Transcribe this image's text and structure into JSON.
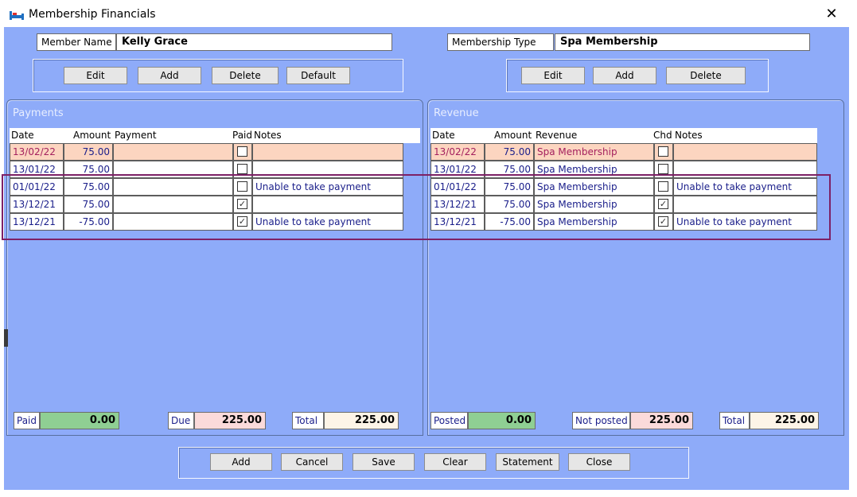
{
  "window": {
    "title": "Membership Financials",
    "close_glyph": "✕",
    "app_icon": "bed-icon"
  },
  "header": {
    "member_name_label": "Member Name",
    "member_name_value": "Kelly Grace",
    "membership_type_label": "Membership Type",
    "membership_type_value": "Spa Membership"
  },
  "left_buttons": [
    "Edit",
    "Add",
    "Delete",
    "Default"
  ],
  "right_buttons": [
    "Edit",
    "Add",
    "Delete"
  ],
  "payments": {
    "title": "Payments",
    "columns": {
      "date": "Date",
      "amount": "Amount",
      "payment": "Payment",
      "paid": "Paid",
      "notes": "Notes"
    },
    "rows": [
      {
        "date": "13/02/22",
        "amount": "75.00",
        "payment": "",
        "paid": false,
        "notes": ""
      },
      {
        "date": "13/01/22",
        "amount": "75.00",
        "payment": "",
        "paid": false,
        "notes": ""
      },
      {
        "date": "01/01/22",
        "amount": "75.00",
        "payment": "",
        "paid": false,
        "notes": "Unable to take payment"
      },
      {
        "date": "13/12/21",
        "amount": "75.00",
        "payment": "",
        "paid": true,
        "notes": ""
      },
      {
        "date": "13/12/21",
        "amount": "-75.00",
        "payment": "",
        "paid": true,
        "notes": "Unable to take payment"
      }
    ],
    "totals": {
      "paid_label": "Paid",
      "paid_value": "0.00",
      "due_label": "Due",
      "due_value": "225.00",
      "total_label": "Total",
      "total_value": "225.00"
    }
  },
  "revenue": {
    "title": "Revenue",
    "columns": {
      "date": "Date",
      "amount": "Amount",
      "revenue": "Revenue",
      "chd": "Chd",
      "notes": "Notes"
    },
    "rows": [
      {
        "date": "13/02/22",
        "amount": "75.00",
        "revenue": "Spa Membership",
        "chd": false,
        "notes": ""
      },
      {
        "date": "13/01/22",
        "amount": "75.00",
        "revenue": "Spa Membership",
        "chd": false,
        "notes": ""
      },
      {
        "date": "01/01/22",
        "amount": "75.00",
        "revenue": "Spa Membership",
        "chd": false,
        "notes": "Unable to take payment"
      },
      {
        "date": "13/12/21",
        "amount": "75.00",
        "revenue": "Spa Membership",
        "chd": true,
        "notes": ""
      },
      {
        "date": "13/12/21",
        "amount": "-75.00",
        "revenue": "Spa Membership",
        "chd": true,
        "notes": "Unable to take payment"
      }
    ],
    "totals": {
      "posted_label": "Posted",
      "posted_value": "0.00",
      "not_posted_label": "Not posted",
      "not_posted_value": "225.00",
      "total_label": "Total",
      "total_value": "225.00"
    }
  },
  "footer_buttons": [
    "Add",
    "Cancel",
    "Save",
    "Clear",
    "Statement",
    "Close"
  ],
  "colors": {
    "client_bg": "#8eabf9",
    "selected_row_bg": "#fcd5c0",
    "paid_box_bg": "#8fcf93",
    "due_box_bg": "#fbdada",
    "total_box_bg": "#fdf4e7",
    "annotation_border": "#7d2166"
  }
}
